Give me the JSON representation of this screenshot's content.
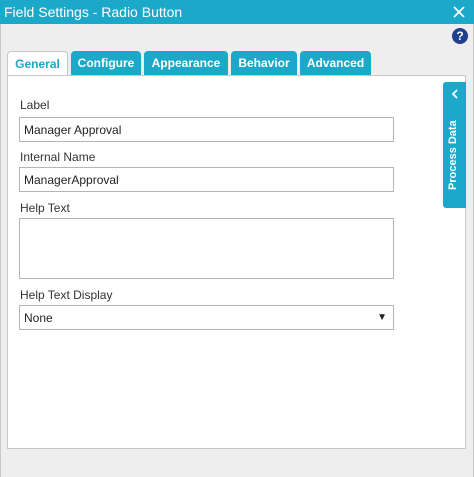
{
  "window": {
    "title": "Field Settings - Radio Button",
    "close_icon": "close-icon",
    "help_label": "?"
  },
  "tabs": [
    {
      "label": "General",
      "active": true
    },
    {
      "label": "Configure",
      "active": false
    },
    {
      "label": "Appearance",
      "active": false
    },
    {
      "label": "Behavior",
      "active": false
    },
    {
      "label": "Advanced",
      "active": false
    }
  ],
  "form": {
    "label": {
      "caption": "Label",
      "value": "Manager Approval"
    },
    "internal_name": {
      "caption": "Internal Name",
      "value": "ManagerApproval"
    },
    "help_text": {
      "caption": "Help Text",
      "value": ""
    },
    "help_text_display": {
      "caption": "Help Text Display",
      "value": "None",
      "arrow": "▼"
    }
  },
  "side_panel": {
    "label": "Process Data",
    "icon": "chevron-left-icon"
  },
  "colors": {
    "accent": "#1ba8c9",
    "help": "#1f3f8f",
    "body_bg": "#eeeeee"
  }
}
